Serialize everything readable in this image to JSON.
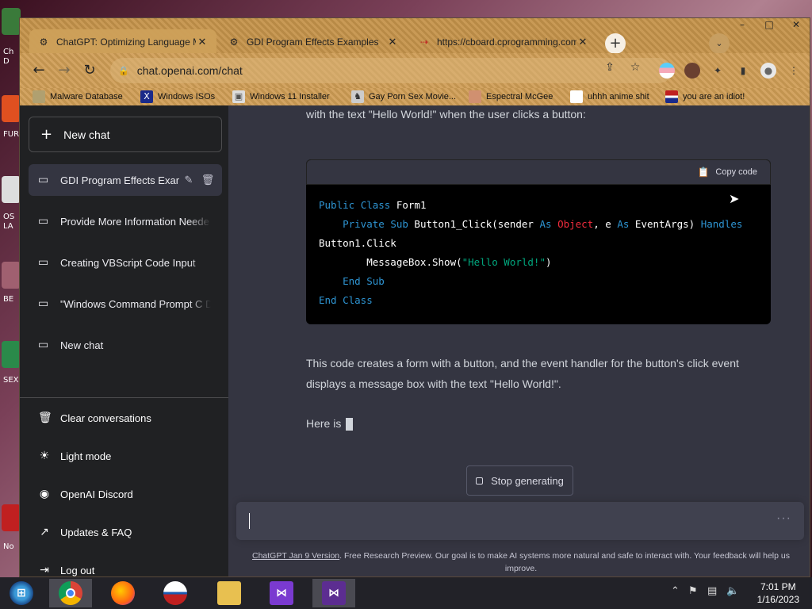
{
  "browser": {
    "tabs": [
      {
        "label": "ChatGPT: Optimizing Language Mo",
        "favicon": "chatgpt-icon",
        "active": true
      },
      {
        "label": "GDI Program Effects Examples",
        "favicon": "chatgpt-icon",
        "active": false
      },
      {
        "label": "https://cboard.cprogramming.com",
        "favicon": "cboard-icon",
        "active": false
      }
    ],
    "new_tab": "+",
    "tab_search": "⌄",
    "window_controls": {
      "minimize": "–",
      "maximize": "□",
      "close": "✕"
    },
    "url": "chat.openai.com/chat",
    "nav": {
      "back": "←",
      "forward": "→",
      "reload": "↻"
    },
    "bookmarks": [
      {
        "label": "Malware Database",
        "icon": "bookmark-generic-icon"
      },
      {
        "label": "Windows ISOs",
        "icon": "x-logo-icon"
      },
      {
        "label": "Windows 11 Installer",
        "icon": "image-icon"
      },
      {
        "label": "Gay Porn Sex Movie...",
        "icon": "bookmark-generic-icon"
      },
      {
        "label": "Espectral McGee",
        "icon": "avatar-icon"
      },
      {
        "label": "uhhh anime shit",
        "icon": "avatar-icon"
      },
      {
        "label": "you are an idiot!",
        "icon": "flag-icon"
      }
    ]
  },
  "sidebar": {
    "new_chat": "New chat",
    "conversations": [
      {
        "label": "GDI Program Effects Exam",
        "active": true
      },
      {
        "label": "Provide More Information Neede",
        "active": false
      },
      {
        "label": "Creating VBScript Code Input",
        "active": false
      },
      {
        "label": "\"Windows Command Prompt C D",
        "active": false
      },
      {
        "label": "New chat",
        "active": false
      }
    ],
    "links": [
      {
        "label": "Clear conversations",
        "icon": "trash-icon"
      },
      {
        "label": "Light mode",
        "icon": "sun-icon"
      },
      {
        "label": "OpenAI Discord",
        "icon": "discord-icon"
      },
      {
        "label": "Updates & FAQ",
        "icon": "external-link-icon"
      },
      {
        "label": "Log out",
        "icon": "logout-icon"
      }
    ]
  },
  "main": {
    "intro_text": "with the text \"Hello World!\" when the user clicks a button:",
    "copy_code": "Copy code",
    "explanation": "This code creates a form with a button, and the event handler for the button's click event displays a message box with the text \"Hello World!\".",
    "partial": "Here is",
    "stop_generating": "Stop generating",
    "input_placeholder": "",
    "footer_link": "ChatGPT Jan 9 Version",
    "footer_text": ". Free Research Preview. Our goal is to make AI systems more natural and safe to interact with. Your feedback will help us improve."
  },
  "taskbar": {
    "apps": [
      "start-icon",
      "chrome-icon",
      "firefox-icon",
      "ie-icon",
      "file-explorer-icon",
      "visual-studio-installer-icon",
      "visual-studio-icon"
    ],
    "time": "7:01 PM",
    "date": "1/16/2023"
  },
  "desktop_labels": [
    "Ch",
    "D",
    "FUR",
    "OS",
    "LA",
    "BE",
    "SEX",
    "No"
  ]
}
